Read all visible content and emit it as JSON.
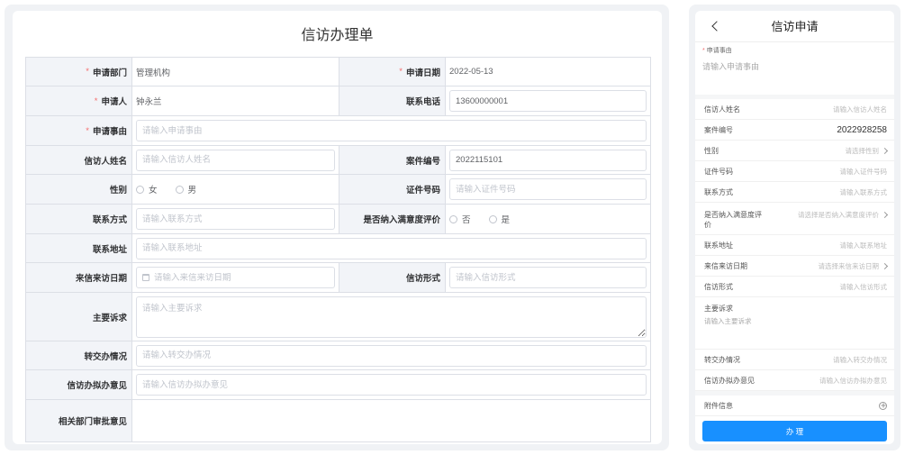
{
  "required_mark": "*",
  "colors": {
    "accent": "#1890ff",
    "required": "#f56c6c",
    "label_bg": "#f2f4f8",
    "border": "#dcdfe6",
    "panel_bg": "#f0f2f5"
  },
  "icons": {
    "back": "chevron-left-icon",
    "select_arrow": "chevron-right-icon",
    "attachment_add": "plus-circle-icon",
    "date": "calendar-icon"
  },
  "desktop": {
    "title": "信访办理单",
    "dept": {
      "label": "申请部门",
      "value": "管理机构"
    },
    "apply_date": {
      "label": "申请日期",
      "value": "2022-05-13"
    },
    "applicant": {
      "label": "申请人",
      "value": "钟永兰"
    },
    "phone": {
      "label": "联系电话",
      "value": "13600000001"
    },
    "reason": {
      "label": "申请事由",
      "placeholder": "请输入申请事由"
    },
    "petitioner_name": {
      "label": "信访人姓名",
      "placeholder": "请输入信访人姓名"
    },
    "case_no": {
      "label": "案件编号",
      "value": "2022115101"
    },
    "gender": {
      "label": "性别",
      "options": [
        "女",
        "男"
      ]
    },
    "id_no": {
      "label": "证件号码",
      "placeholder": "请输入证件号码"
    },
    "contact": {
      "label": "联系方式",
      "placeholder": "请输入联系方式"
    },
    "satisfaction": {
      "label": "是否纳入满意度评价",
      "options": [
        "否",
        "是"
      ]
    },
    "address": {
      "label": "联系地址",
      "placeholder": "请输入联系地址"
    },
    "visit_date": {
      "label": "来信来访日期",
      "placeholder": "请输入来信来访日期"
    },
    "form_type": {
      "label": "信访形式",
      "placeholder": "请输入信访形式"
    },
    "appeal": {
      "label": "主要诉求",
      "placeholder": "请输入主要诉求"
    },
    "transfer": {
      "label": "转交办情况",
      "placeholder": "请输入转交办情况"
    },
    "office_opinion": {
      "label": "信访办拟办意见",
      "placeholder": "请输入信访办拟办意见"
    },
    "dept_opinion": {
      "label": "相关部门审批意见"
    }
  },
  "mobile": {
    "title": "信访申请",
    "reason": {
      "label": "申请事由",
      "placeholder": "请输入申请事由"
    },
    "petitioner_name": {
      "label": "信访人姓名",
      "placeholder": "请输入信访人姓名"
    },
    "case_no": {
      "label": "案件编号",
      "value": "2022928258"
    },
    "gender": {
      "label": "性别",
      "placeholder": "请选择性别"
    },
    "id_no": {
      "label": "证件号码",
      "placeholder": "请输入证件号码"
    },
    "contact": {
      "label": "联系方式",
      "placeholder": "请输入联系方式"
    },
    "satisfaction": {
      "label": "是否纳入满意度评价",
      "placeholder": "请选择是否纳入满意度评价"
    },
    "address": {
      "label": "联系地址",
      "placeholder": "请输入联系地址"
    },
    "visit_date": {
      "label": "来信来访日期",
      "placeholder": "请选择来信来访日期"
    },
    "form_type": {
      "label": "信访形式",
      "placeholder": "请输入信访形式"
    },
    "appeal": {
      "label": "主要诉求",
      "placeholder": "请输入主要诉求"
    },
    "transfer": {
      "label": "转交办情况",
      "placeholder": "请输入转交办情况"
    },
    "office_opinion": {
      "label": "信访办拟办意见",
      "placeholder": "请输入信访办拟办意见"
    },
    "attachment": {
      "label": "附件信息"
    },
    "submit_label": "办 理"
  }
}
